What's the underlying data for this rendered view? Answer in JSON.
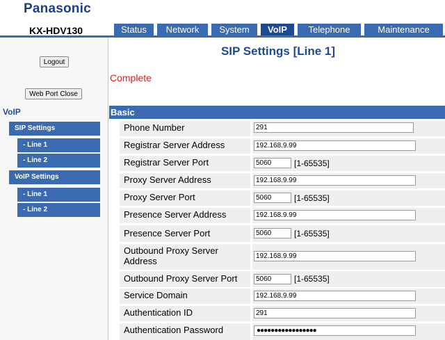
{
  "header": {
    "brand": "Panasonic",
    "model": "KX-HDV130"
  },
  "tabs": [
    {
      "label": "Status",
      "active": false
    },
    {
      "label": "Network",
      "active": false
    },
    {
      "label": "System",
      "active": false
    },
    {
      "label": "VoIP",
      "active": true
    },
    {
      "label": "Telephone",
      "active": false
    },
    {
      "label": "Maintenance",
      "active": false
    }
  ],
  "sidebar": {
    "logout": "Logout",
    "web_port_close": "Web Port Close",
    "section": "VoIP",
    "items": [
      {
        "label": "SIP Settings"
      },
      {
        "label": "- Line 1"
      },
      {
        "label": "- Line 2"
      },
      {
        "label": "VoIP Settings"
      },
      {
        "label": "- Line 1"
      },
      {
        "label": "- Line 2"
      }
    ]
  },
  "main": {
    "title": "SIP Settings [Line 1]",
    "status": "Complete",
    "section": "Basic",
    "fields": [
      {
        "label": "Phone Number",
        "value": "291"
      },
      {
        "label": "Registrar Server Address",
        "value": "192.168.9.99"
      },
      {
        "label": "Registrar Server Port",
        "value": "5060",
        "range": "[1-65535]"
      },
      {
        "label": "Proxy Server Address",
        "value": "192.168.9.99"
      },
      {
        "label": "Proxy Server Port",
        "value": "5060",
        "range": "[1-65535]"
      },
      {
        "label": "Presence Server Address",
        "value": "192.168.9.99"
      },
      {
        "label": "Presence Server Port",
        "value": "5060",
        "range": "[1-65535]"
      },
      {
        "label": "Outbound Proxy Server Address",
        "value": "192.168.9.99"
      },
      {
        "label": "Outbound Proxy Server Port",
        "value": "5060",
        "range": "[1-65535]"
      },
      {
        "label": "Service Domain",
        "value": "192.168.9.99"
      },
      {
        "label": "Authentication ID",
        "value": "291"
      },
      {
        "label": "Authentication Password",
        "value": "●●●●●●●●●●●●●●●●●"
      }
    ]
  }
}
